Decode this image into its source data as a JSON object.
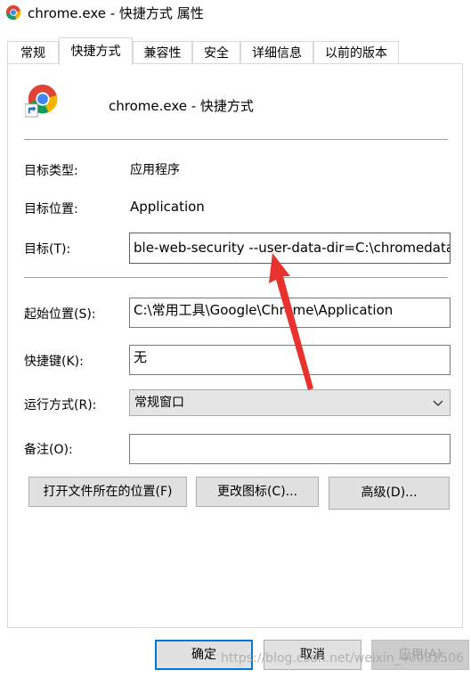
{
  "window": {
    "title": "chrome.exe - 快捷方式 属性",
    "icon": "chrome-icon"
  },
  "tabs": [
    {
      "label": "常规",
      "active": false
    },
    {
      "label": "快捷方式",
      "active": true
    },
    {
      "label": "兼容性",
      "active": false
    },
    {
      "label": "安全",
      "active": false
    },
    {
      "label": "详细信息",
      "active": false
    },
    {
      "label": "以前的版本",
      "active": false
    }
  ],
  "shortcut": {
    "name": "chrome.exe - 快捷方式",
    "icon": "chrome-shortcut-icon"
  },
  "fields": {
    "target_type_label": "目标类型:",
    "target_type_value": "应用程序",
    "target_location_label": "目标位置:",
    "target_location_value": "Application",
    "target_label": "目标(T):",
    "target_value": "ble-web-security --user-data-dir=C:\\chromedata",
    "start_in_label": "起始位置(S):",
    "start_in_value": "C:\\常用工具\\Google\\Chrome\\Application",
    "hotkey_label": "快捷键(K):",
    "hotkey_value": "无",
    "run_label": "运行方式(R):",
    "run_value": "常规窗口",
    "comment_label": "备注(O):",
    "comment_value": ""
  },
  "buttons": {
    "open_location": "打开文件所在的位置(F)",
    "change_icon": "更改图标(C)...",
    "advanced": "高级(D)...",
    "ok": "确定",
    "cancel": "取消",
    "apply": "应用(A)"
  },
  "watermark": "https://blog.csdn.net/weixin_40032506",
  "colors": {
    "focus_border": "#0078d7",
    "annotation_arrow": "#e8322e"
  }
}
